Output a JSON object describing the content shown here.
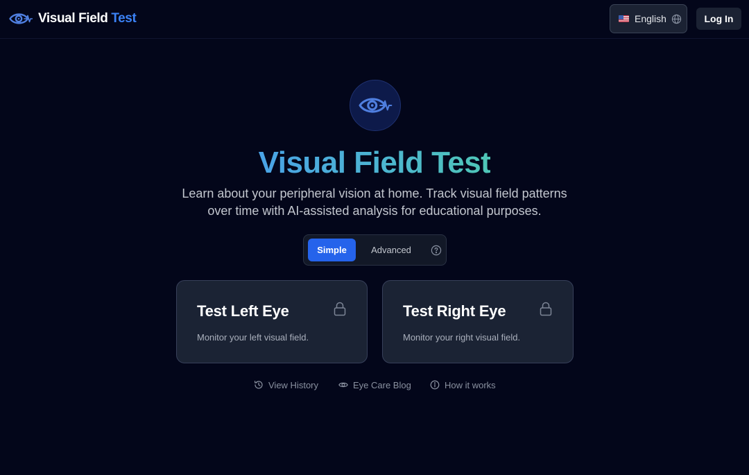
{
  "header": {
    "brand": {
      "word1": "Visual Field",
      "word2": "Test",
      "icon": "eye-pulse-icon"
    },
    "language": {
      "label": "English",
      "flag": "us-flag-icon",
      "icon": "globe-icon"
    },
    "login_label": "Log In"
  },
  "hero": {
    "icon": "eye-pulse-icon",
    "title": "Visual Field Test",
    "subtitle": "Learn about your peripheral vision at home. Track visual field patterns over time with AI-assisted analysis for educational purposes."
  },
  "mode_toggle": {
    "options": [
      "Simple",
      "Advanced"
    ],
    "selected": "Simple",
    "help_icon": "question-circle-icon"
  },
  "cards": [
    {
      "title": "Test Left Eye",
      "description": "Monitor your left visual field.",
      "icon": "lock-icon"
    },
    {
      "title": "Test Right Eye",
      "description": "Monitor your right visual field.",
      "icon": "lock-icon"
    }
  ],
  "links": [
    {
      "label": "View History",
      "icon": "history-icon"
    },
    {
      "label": "Eye Care Blog",
      "icon": "eye-icon"
    },
    {
      "label": "How it works",
      "icon": "info-circle-icon"
    }
  ],
  "colors": {
    "background": "#03061a",
    "accent": "#2563eb",
    "brand_blue": "#3b82f6",
    "card": "#1b2334",
    "title_gradient": [
      "#4aa3e6",
      "#4fc6b7"
    ]
  }
}
